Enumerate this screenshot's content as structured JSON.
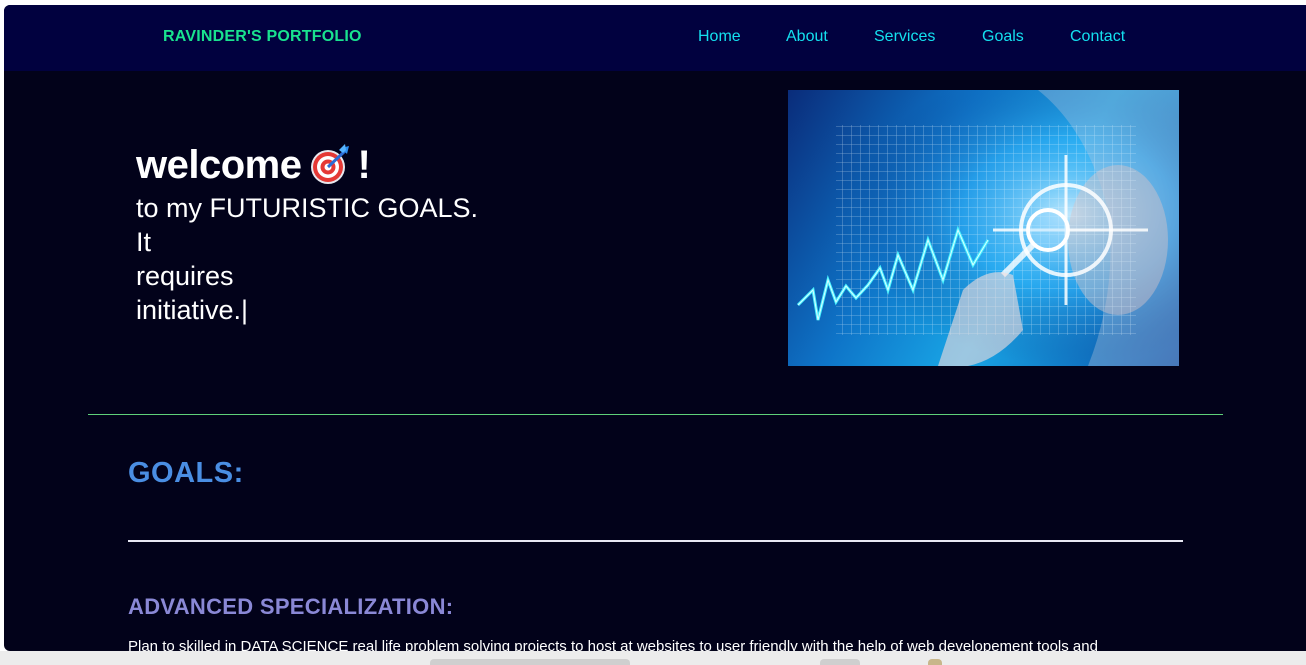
{
  "navbar": {
    "brand": "RAVINDER'S PORTFOLIO",
    "links": [
      "Home",
      "About",
      "Services",
      "Goals",
      "Contact"
    ]
  },
  "hero": {
    "welcome": "welcome",
    "exclaim": "!",
    "emoji_icon": "direct-hit-target-icon",
    "typed_line1": "to my FUTURISTIC GOALS.",
    "typed_line2": "It",
    "typed_line3": "requires",
    "typed_line4": "initiative.",
    "cursor": "|"
  },
  "goals": {
    "title": "GOALS:"
  },
  "specialization": {
    "title": "ADVANCED SPECIALIZATION:",
    "text": "Plan to skilled in DATA SCIENCE real life problem solving projects to host at websites to user friendly with the help of web developement tools and"
  },
  "colors": {
    "page_bg": "#02021a",
    "navbar_bg": "#01013f",
    "brand": "#19e28f",
    "nav_link": "#14e0ef",
    "goals_title": "#4a8ee3",
    "spec_title": "#8a88d6",
    "divider_green": "#5fd07a"
  }
}
